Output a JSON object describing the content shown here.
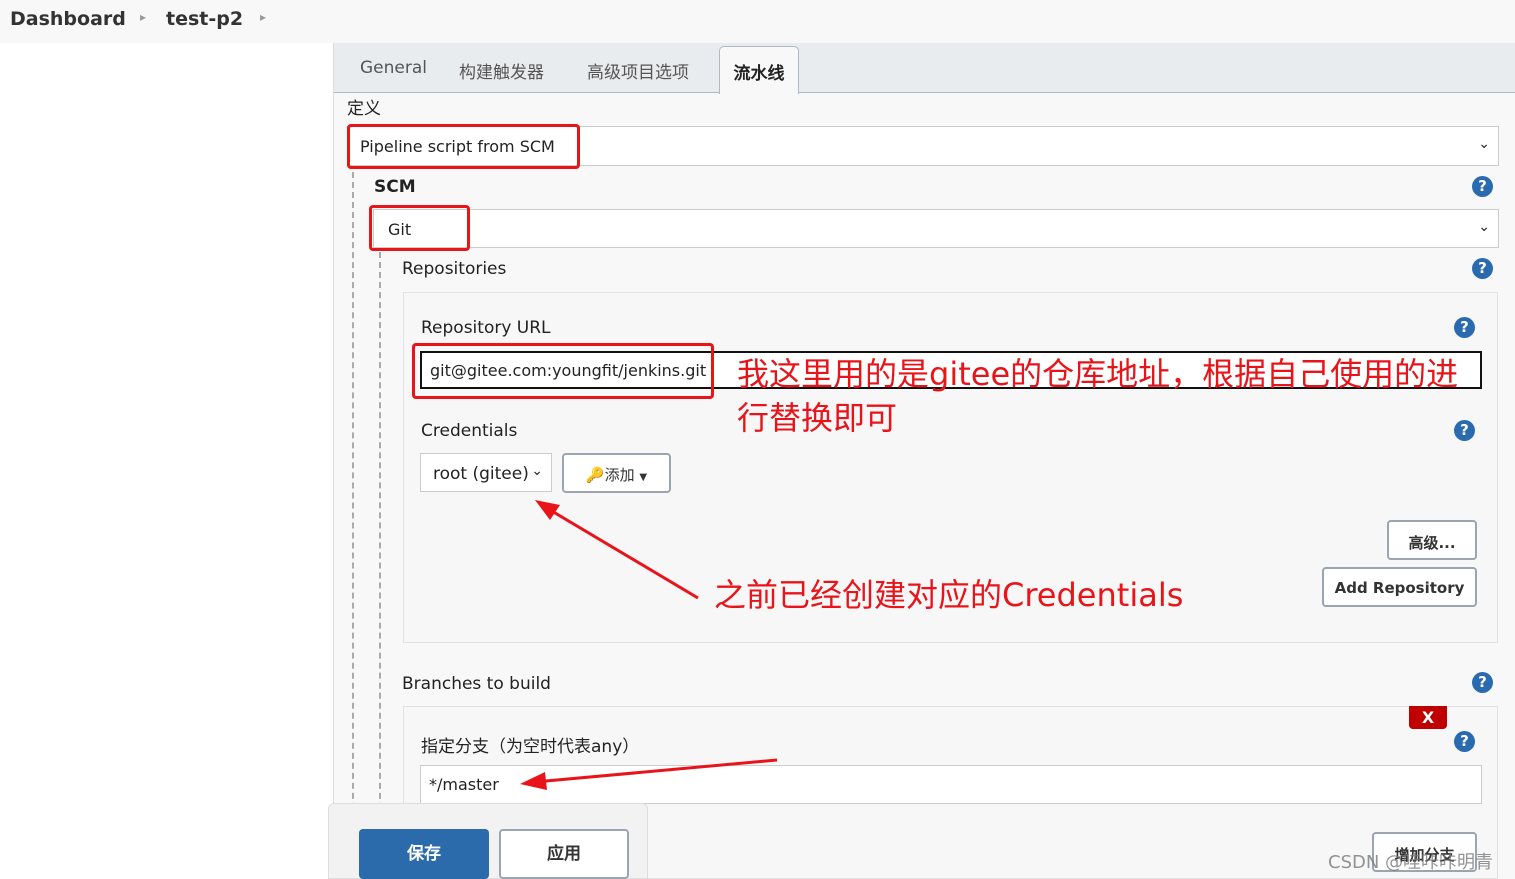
{
  "breadcrumb": {
    "items": [
      "Dashboard",
      "test-p2"
    ]
  },
  "tabs": [
    {
      "label": "General"
    },
    {
      "label": "构建触发器"
    },
    {
      "label": "高级项目选项"
    },
    {
      "label": "流水线",
      "active": true
    }
  ],
  "definition": {
    "label": "定义",
    "value": "Pipeline script from SCM"
  },
  "scm": {
    "label": "SCM",
    "value": "Git"
  },
  "repositories": {
    "label": "Repositories",
    "url_label": "Repository URL",
    "url_value": "git@gitee.com:youngfit/jenkins.git",
    "credentials_label": "Credentials",
    "credentials_value": "root (gitee)",
    "add_label": "添加",
    "advanced_label": "高级...",
    "add_repository_label": "Add Repository"
  },
  "branches": {
    "label": "Branches to build",
    "spec_label": "指定分支（为空时代表any）",
    "spec_value": "*/master",
    "delete_label": "X",
    "add_branch_label": "增加分支"
  },
  "annotations": {
    "url_note": "我这里用的是gitee的仓库地址，根据自己使用的进行替换即可",
    "cred_note": "之前已经创建对应的Credentials"
  },
  "footer": {
    "save_label": "保存",
    "apply_label": "应用"
  },
  "watermark": "CSDN @哇咔咔明青",
  "colors": {
    "annotation": "#e8141a",
    "primary": "#2c6bab",
    "help": "#2a6bb0",
    "delete": "#c00000"
  }
}
